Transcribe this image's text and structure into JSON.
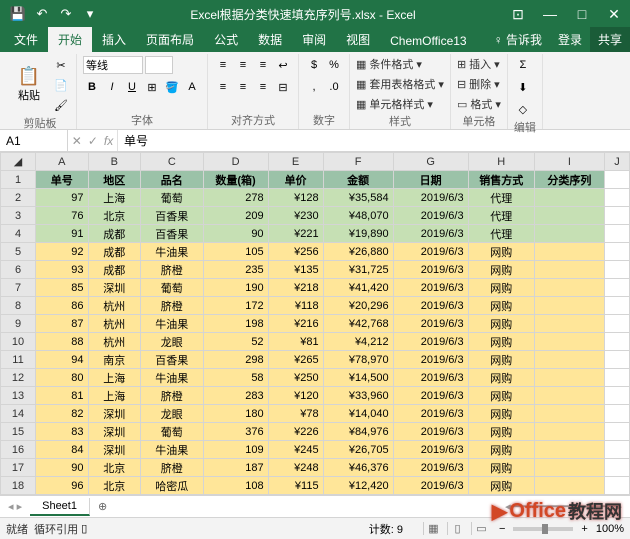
{
  "titlebar": {
    "title": "Excel根据分类快速填充序列号.xlsx - Excel"
  },
  "tabs": {
    "file": "文件",
    "home": "开始",
    "insert": "插入",
    "layout": "页面布局",
    "formulas": "公式",
    "data": "数据",
    "review": "审阅",
    "view": "视图",
    "chemoffice": "ChemOffice13",
    "tellme": "告诉我",
    "login": "登录",
    "share": "共享"
  },
  "ribbon": {
    "clipboard": {
      "label": "剪贴板",
      "paste": "粘贴"
    },
    "font": {
      "label": "字体",
      "name": "等线",
      "bold": "B",
      "italic": "I",
      "underline": "U"
    },
    "align": {
      "label": "对齐方式"
    },
    "number": {
      "label": "数字"
    },
    "styles": {
      "label": "样式",
      "cond": "条件格式",
      "table": "套用表格格式",
      "cell": "单元格样式"
    },
    "cells": {
      "label": "单元格",
      "insert": "插入",
      "delete": "删除",
      "format": "格式"
    },
    "editing": {
      "label": "编辑"
    }
  },
  "fx": {
    "namebox": "A1",
    "formula": "单号",
    "fx_icon": "fx"
  },
  "columns": [
    "A",
    "B",
    "C",
    "D",
    "E",
    "F",
    "G",
    "H",
    "I",
    "J"
  ],
  "headers": [
    "单号",
    "地区",
    "品名",
    "数量(箱)",
    "单价",
    "金额",
    "日期",
    "销售方式",
    "分类序列"
  ],
  "rows": [
    {
      "n": 2,
      "c": "green",
      "d": [
        97,
        "上海",
        "葡萄",
        278,
        "¥128",
        "¥35,584",
        "2019/6/3",
        "代理",
        ""
      ]
    },
    {
      "n": 3,
      "c": "green",
      "d": [
        76,
        "北京",
        "百香果",
        209,
        "¥230",
        "¥48,070",
        "2019/6/3",
        "代理",
        ""
      ]
    },
    {
      "n": 4,
      "c": "green",
      "d": [
        91,
        "成都",
        "百香果",
        90,
        "¥221",
        "¥19,890",
        "2019/6/3",
        "代理",
        ""
      ]
    },
    {
      "n": 5,
      "c": "yellow",
      "d": [
        92,
        "成都",
        "牛油果",
        105,
        "¥256",
        "¥26,880",
        "2019/6/3",
        "网购",
        ""
      ]
    },
    {
      "n": 6,
      "c": "yellow",
      "d": [
        93,
        "成都",
        "脐橙",
        235,
        "¥135",
        "¥31,725",
        "2019/6/3",
        "网购",
        ""
      ]
    },
    {
      "n": 7,
      "c": "yellow",
      "d": [
        85,
        "深圳",
        "葡萄",
        190,
        "¥218",
        "¥41,420",
        "2019/6/3",
        "网购",
        ""
      ]
    },
    {
      "n": 8,
      "c": "yellow",
      "d": [
        86,
        "杭州",
        "脐橙",
        172,
        "¥118",
        "¥20,296",
        "2019/6/3",
        "网购",
        ""
      ]
    },
    {
      "n": 9,
      "c": "yellow",
      "d": [
        87,
        "杭州",
        "牛油果",
        198,
        "¥216",
        "¥42,768",
        "2019/6/3",
        "网购",
        ""
      ]
    },
    {
      "n": 10,
      "c": "yellow",
      "d": [
        88,
        "杭州",
        "龙眼",
        52,
        "¥81",
        "¥4,212",
        "2019/6/3",
        "网购",
        ""
      ]
    },
    {
      "n": 11,
      "c": "yellow",
      "d": [
        94,
        "南京",
        "百香果",
        298,
        "¥265",
        "¥78,970",
        "2019/6/3",
        "网购",
        ""
      ]
    },
    {
      "n": 12,
      "c": "yellow",
      "d": [
        80,
        "上海",
        "牛油果",
        58,
        "¥250",
        "¥14,500",
        "2019/6/3",
        "网购",
        ""
      ]
    },
    {
      "n": 13,
      "c": "yellow",
      "d": [
        81,
        "上海",
        "脐橙",
        283,
        "¥120",
        "¥33,960",
        "2019/6/3",
        "网购",
        ""
      ]
    },
    {
      "n": 14,
      "c": "yellow",
      "d": [
        82,
        "深圳",
        "龙眼",
        180,
        "¥78",
        "¥14,040",
        "2019/6/3",
        "网购",
        ""
      ]
    },
    {
      "n": 15,
      "c": "yellow",
      "d": [
        83,
        "深圳",
        "葡萄",
        376,
        "¥226",
        "¥84,976",
        "2019/6/3",
        "网购",
        ""
      ]
    },
    {
      "n": 16,
      "c": "yellow",
      "d": [
        84,
        "深圳",
        "牛油果",
        109,
        "¥245",
        "¥26,705",
        "2019/6/3",
        "网购",
        ""
      ]
    },
    {
      "n": 17,
      "c": "yellow",
      "d": [
        90,
        "北京",
        "脐橙",
        187,
        "¥248",
        "¥46,376",
        "2019/6/3",
        "网购",
        ""
      ]
    },
    {
      "n": 18,
      "c": "yellow",
      "d": [
        96,
        "北京",
        "哈密瓜",
        108,
        "¥115",
        "¥12,420",
        "2019/6/3",
        "网购",
        ""
      ]
    }
  ],
  "sheet": "Sheet1",
  "status": {
    "ready": "就绪",
    "circ": "循环引用",
    "count_label": "计数: 9",
    "zoom": "100%"
  },
  "watermark": {
    "a": "Office",
    "b": "教程网"
  }
}
